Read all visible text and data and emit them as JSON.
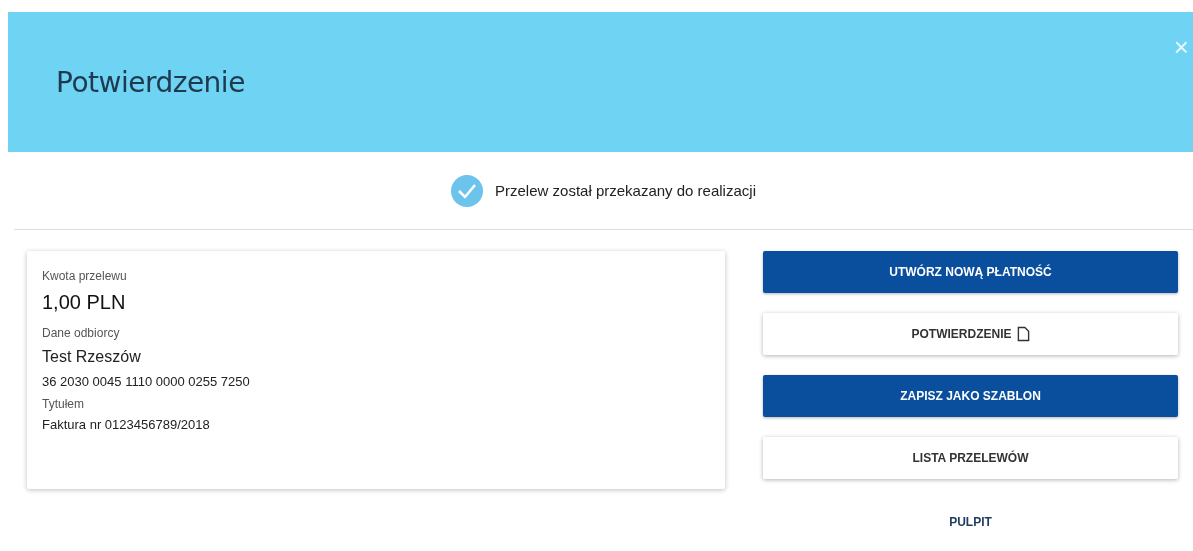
{
  "dialog": {
    "title": "Potwierdzenie",
    "close": "×"
  },
  "status": {
    "message": "Przelew został przekazany do realizacji"
  },
  "details": [
    {
      "kind": "label",
      "text": "Kwota przelewu"
    },
    {
      "kind": "amount",
      "text": "1,00  PLN"
    },
    {
      "kind": "label",
      "text": "Dane odbiorcy"
    },
    {
      "kind": "name",
      "text": "Test Rzeszów"
    },
    {
      "kind": "value",
      "text": "36 2030 0045 1110 0000 0255 7250"
    },
    {
      "kind": "label",
      "text": "Tytułem"
    },
    {
      "kind": "value",
      "text": "Faktura nr 0123456789/2018"
    }
  ],
  "actions": [
    {
      "kind": "primary",
      "label": "UTWÓRZ NOWĄ PŁATNOŚĆ",
      "icon": false
    },
    {
      "kind": "secondary",
      "label": "POTWIERDZENIE",
      "icon": true
    },
    {
      "kind": "primary",
      "label": "ZAPISZ JAKO SZABLON",
      "icon": false
    },
    {
      "kind": "secondary",
      "label": "LISTA PRZELEWÓW",
      "icon": false
    },
    {
      "kind": "link",
      "label": "PULPIT",
      "icon": false
    }
  ]
}
